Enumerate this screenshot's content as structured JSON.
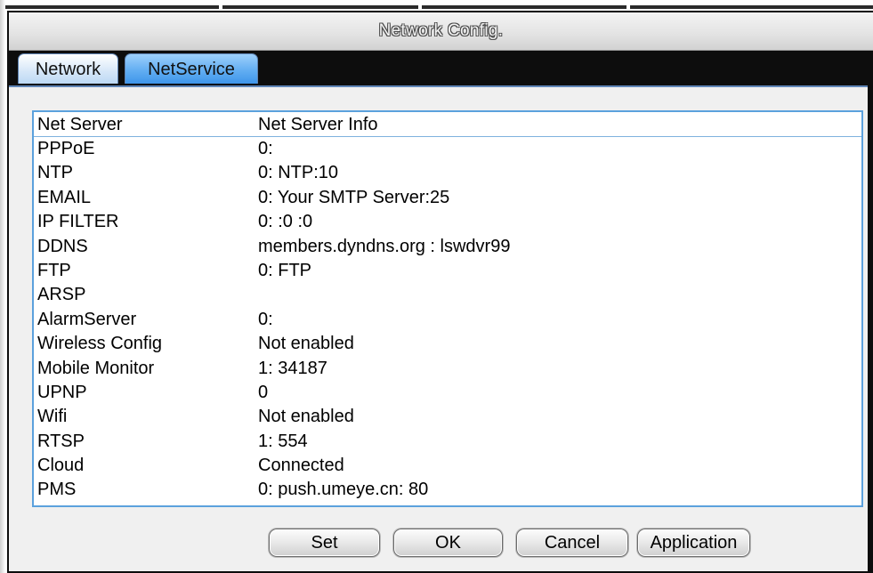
{
  "window": {
    "title": "Network Config."
  },
  "tabs": [
    {
      "label": "Network",
      "active": false
    },
    {
      "label": "NetService",
      "active": true
    }
  ],
  "list": {
    "headers": [
      "Net Server",
      "Net Server Info"
    ],
    "rows": [
      {
        "name": "PPPoE",
        "info": "0:"
      },
      {
        "name": "NTP",
        "info": "0: NTP:10"
      },
      {
        "name": "EMAIL",
        "info": "0: Your SMTP Server:25"
      },
      {
        "name": "IP FILTER",
        "info": "0: :0 :0"
      },
      {
        "name": "DDNS",
        "info": "members.dyndns.org : lswdvr99"
      },
      {
        "name": "FTP",
        "info": "0: FTP"
      },
      {
        "name": "ARSP",
        "info": ""
      },
      {
        "name": "AlarmServer",
        "info": "0:"
      },
      {
        "name": "Wireless Config",
        "info": "Not enabled"
      },
      {
        "name": "Mobile Monitor",
        "info": "1: 34187"
      },
      {
        "name": "UPNP",
        "info": "0"
      },
      {
        "name": "Wifi",
        "info": "Not enabled"
      },
      {
        "name": "RTSP",
        "info": "1: 554"
      },
      {
        "name": "Cloud",
        "info": "Connected"
      },
      {
        "name": "PMS",
        "info": "0: push.umeye.cn: 80"
      }
    ]
  },
  "buttons": {
    "set": "Set",
    "ok": "OK",
    "cancel": "Cancel",
    "application": "Application"
  }
}
